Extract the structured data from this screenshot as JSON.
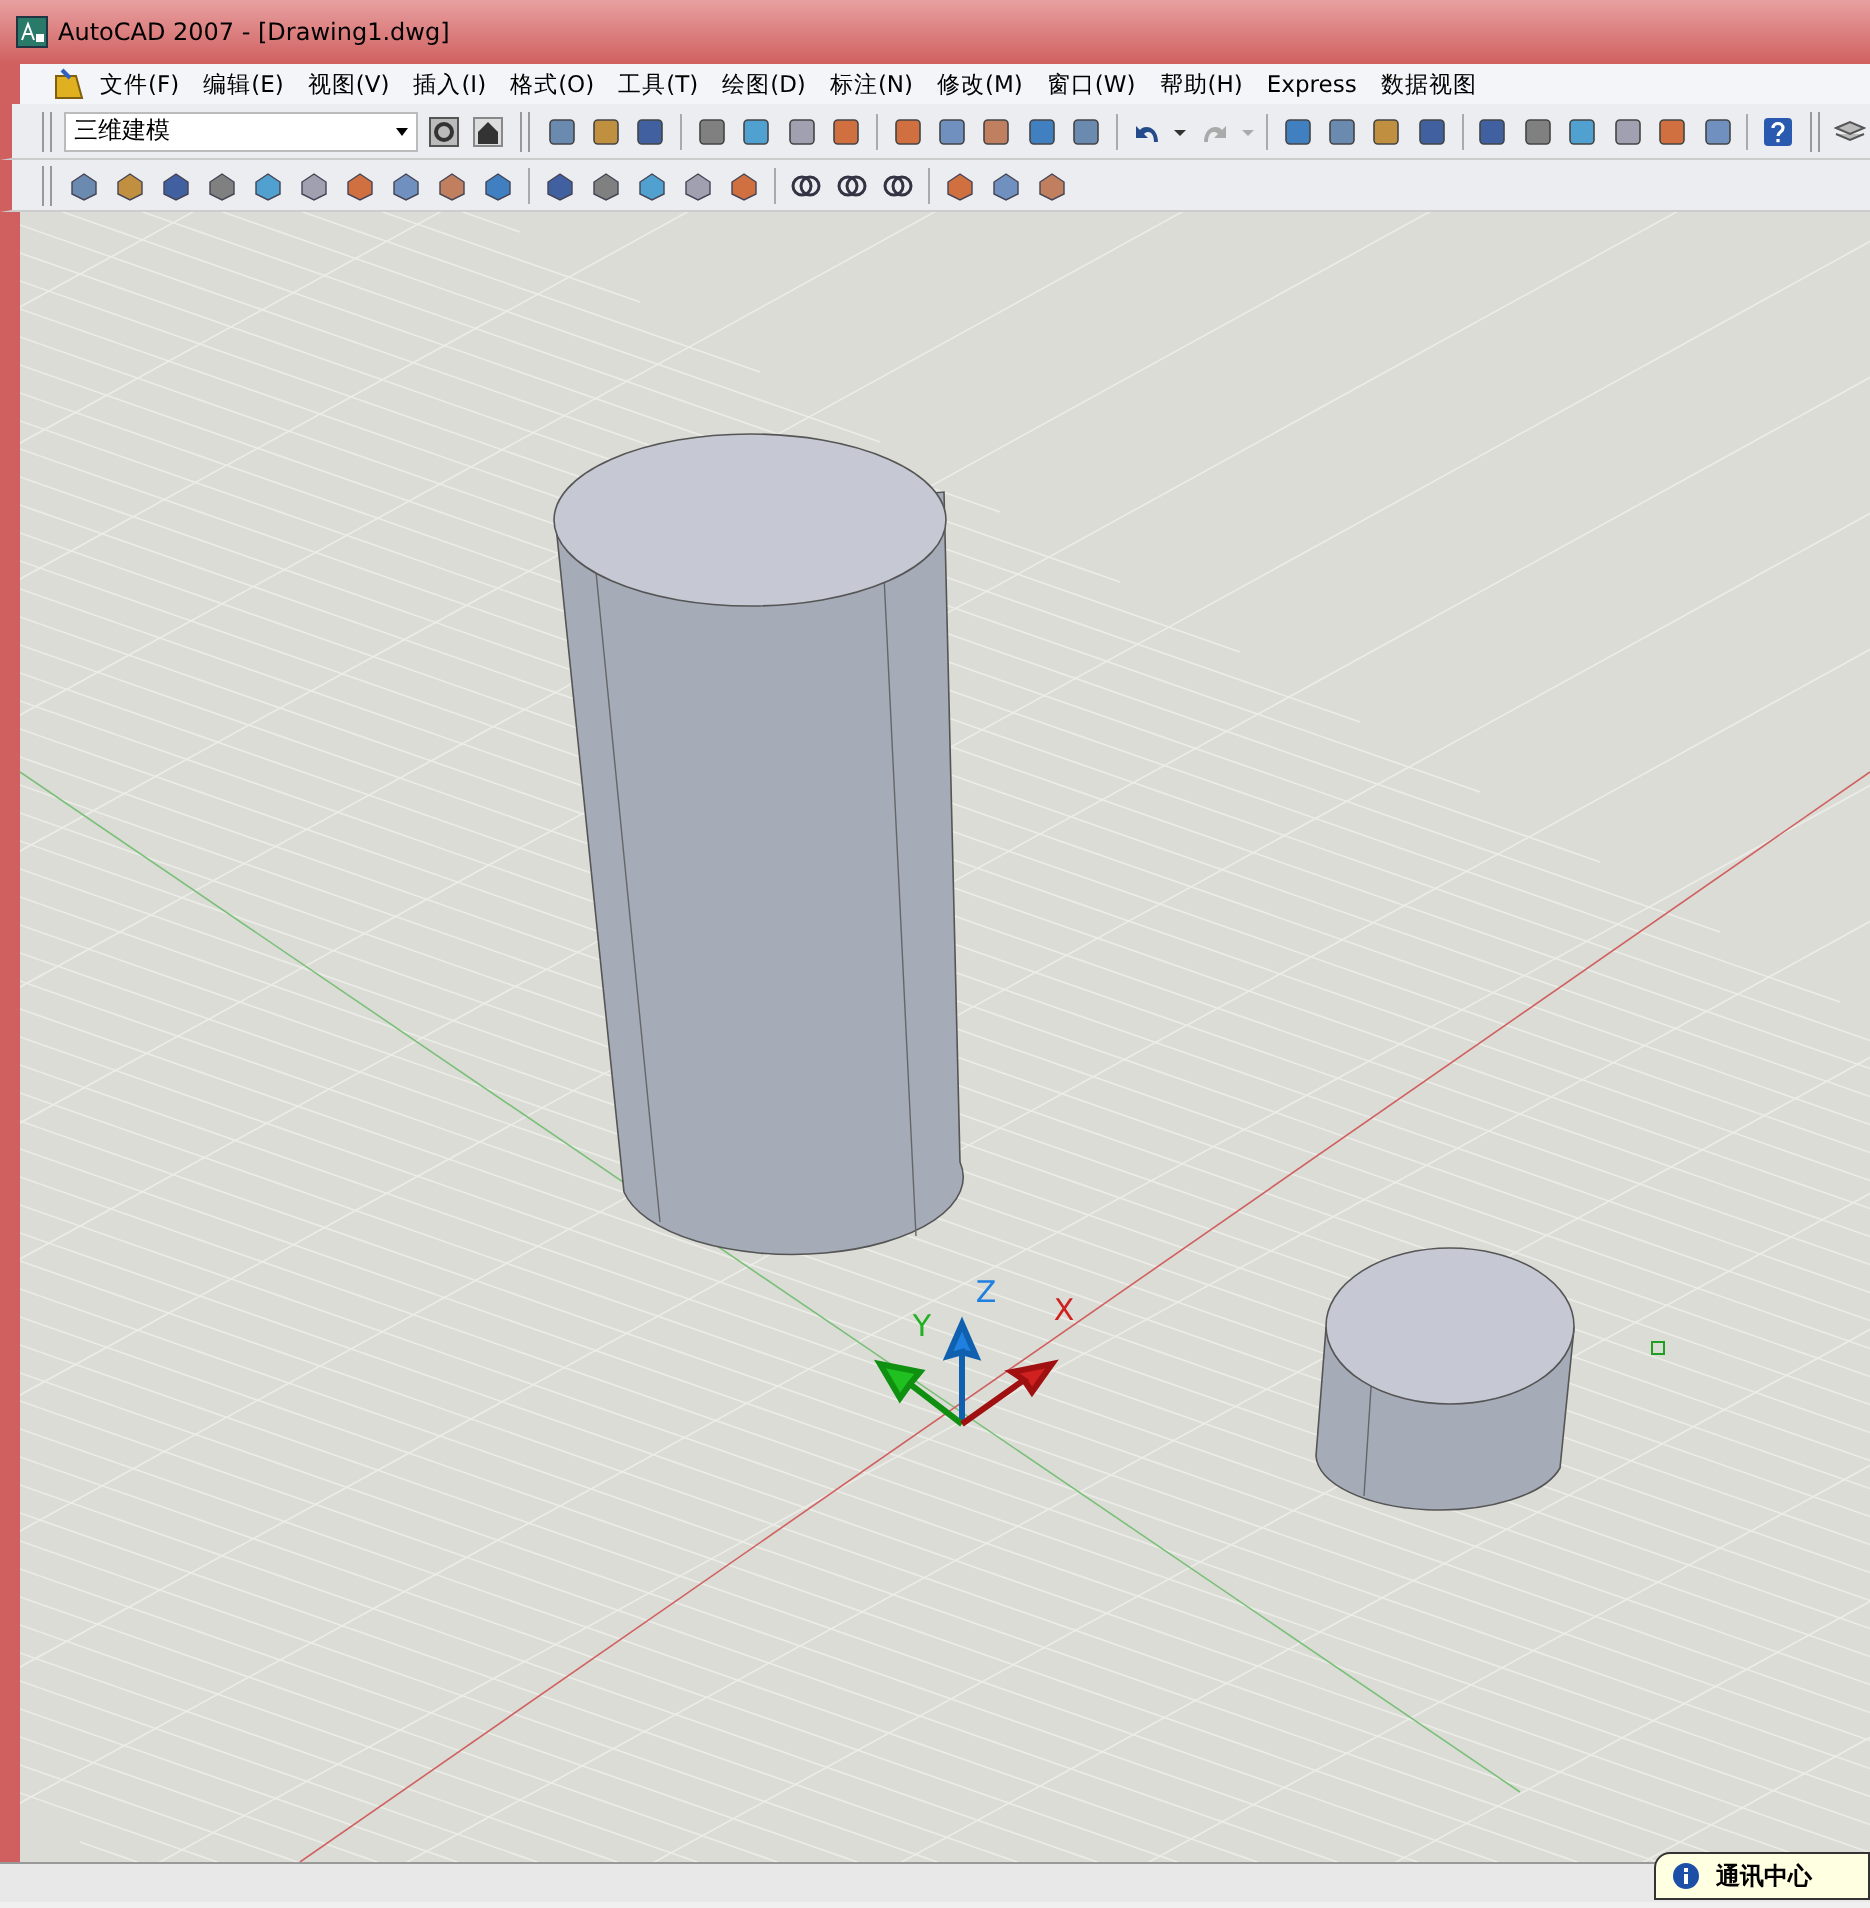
{
  "window": {
    "title": "AutoCAD 2007 - [Drawing1.dwg]"
  },
  "menu": [
    "文件(F)",
    "编辑(E)",
    "视图(V)",
    "插入(I)",
    "格式(O)",
    "工具(T)",
    "绘图(D)",
    "标注(N)",
    "修改(M)",
    "窗口(W)",
    "帮助(H)",
    "Express",
    "数据视图"
  ],
  "workspace_dropdown": {
    "value": "三维建模"
  },
  "ucs_axes": [
    {
      "label": "Z",
      "color": "#2080e0"
    },
    {
      "label": "Y",
      "color": "#20b020"
    },
    {
      "label": "X",
      "color": "#d02020"
    }
  ],
  "notification": {
    "text": "通讯中心"
  }
}
